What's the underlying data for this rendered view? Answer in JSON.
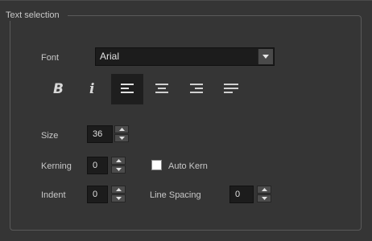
{
  "group": {
    "title": "Text selection"
  },
  "font": {
    "label": "Font",
    "value": "Arial"
  },
  "toolbar": {
    "bold_icon": "bold-icon",
    "italic_icon": "italic-icon",
    "align_left_icon": "align-left-icon",
    "align_center_icon": "align-center-icon",
    "align_right_icon": "align-right-icon",
    "justify_icon": "justify-icon",
    "active": "align-left"
  },
  "size": {
    "label": "Size",
    "value": "36"
  },
  "kerning": {
    "label": "Kerning",
    "value": "0"
  },
  "auto_kern": {
    "label": "Auto Kern",
    "checked": false
  },
  "indent": {
    "label": "Indent",
    "value": "0"
  },
  "line_spacing": {
    "label": "Line Spacing",
    "value": "0"
  },
  "colors": {
    "background": "#353535",
    "field": "#1c1c1c",
    "active_button": "#1e1e1e"
  }
}
